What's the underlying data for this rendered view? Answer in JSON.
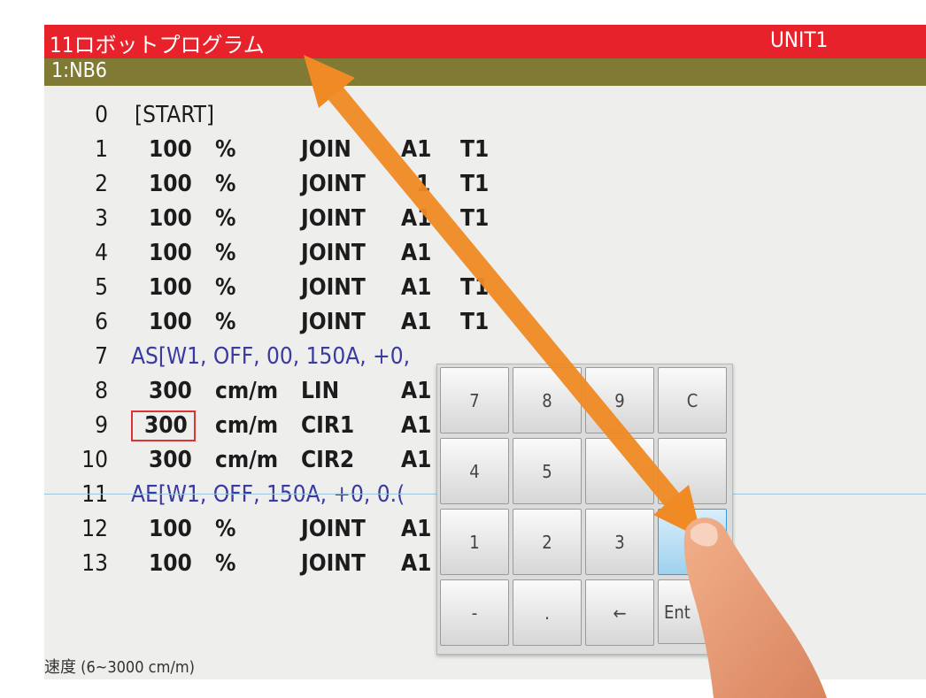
{
  "window": {
    "title": "11ロボットプログラム",
    "unit": "UNIT1"
  },
  "program": {
    "name": "1:NB6"
  },
  "lines": [
    {
      "no": "0",
      "text": "[START]"
    },
    {
      "no": "1",
      "speed": "100",
      "unit": "%",
      "interp": "JOIN",
      "acc": "A1",
      "tool": "T1"
    },
    {
      "no": "2",
      "speed": "100",
      "unit": "%",
      "interp": "JOINT",
      "acc": "1",
      "tool": "T1"
    },
    {
      "no": "3",
      "speed": "100",
      "unit": "%",
      "interp": "JOINT",
      "acc": "A1",
      "tool": "T1"
    },
    {
      "no": "4",
      "speed": "100",
      "unit": "%",
      "interp": "JOINT",
      "acc": "A1",
      "tool": ""
    },
    {
      "no": "5",
      "speed": "100",
      "unit": "%",
      "interp": "JOINT",
      "acc": "A1",
      "tool": "T1"
    },
    {
      "no": "6",
      "speed": "100",
      "unit": "%",
      "interp": "JOINT",
      "acc": "A1",
      "tool": "T1"
    },
    {
      "no": "7",
      "text": "AS[W1, OFF, 00, 150A,  +0,"
    },
    {
      "no": "8",
      "speed": "300",
      "unit": "cm/m",
      "interp": "LIN",
      "acc": "A1"
    },
    {
      "no": "9",
      "speed": "300",
      "unit": "cm/m",
      "interp": "CIR1",
      "acc": "A1"
    },
    {
      "no": "10",
      "speed": "300",
      "unit": "cm/m",
      "interp": "CIR2",
      "acc": "A1"
    },
    {
      "no": "11",
      "text": "AE[W1, OFF, 150A,  +0, 0.("
    },
    {
      "no": "12",
      "speed": "100",
      "unit": "%",
      "interp": "JOINT",
      "acc": "A1"
    },
    {
      "no": "13",
      "speed": "100",
      "unit": "%",
      "interp": "JOINT",
      "acc": "A1"
    }
  ],
  "status": "速度 (6~3000 cm/m)",
  "keypad": {
    "keys": [
      "7",
      "8",
      "9",
      "C",
      "4",
      "5",
      "",
      "",
      "1",
      "2",
      "3",
      "",
      "-",
      ".",
      "←",
      "Ent"
    ]
  },
  "colors": {
    "title_bar": "#e8222a",
    "program_bar": "#807a34",
    "arrow": "#f08a24",
    "enter_key": "#9fd1ef"
  }
}
